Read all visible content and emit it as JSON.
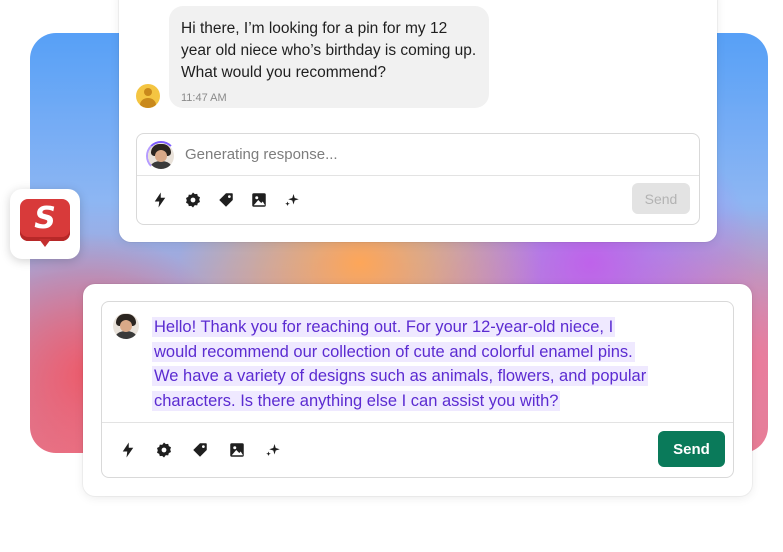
{
  "colors": {
    "accent_purple": "#5b2bd1",
    "highlight": "#efe9ff",
    "send_green": "#0a7a5a",
    "app_red": "#d83a3a"
  },
  "app_icon": {
    "letter": "S",
    "icon": "app-logo-icon"
  },
  "top_card": {
    "customer_message": "Hi there, I’m looking for a pin for my 12 year old niece who’s birthday is coming up. What would you recommend?",
    "timestamp": "11:47 AM",
    "composer": {
      "placeholder": "Generating response...",
      "send_label": "Send",
      "send_enabled": false
    }
  },
  "bottom_card": {
    "composer": {
      "draft_lines": [
        "Hello! Thank you for reaching out. For your 12-year-old niece, I",
        "would recommend our collection of cute and colorful enamel pins.",
        "We have a variety of designs such as animals, flowers, and popular",
        "characters. Is there anything else I can assist you with?"
      ],
      "send_label": "Send",
      "send_enabled": true
    }
  },
  "toolbar_icons": [
    "lightning-icon",
    "badge-gear-icon",
    "tag-icon",
    "image-icon",
    "sparkles-icon"
  ]
}
